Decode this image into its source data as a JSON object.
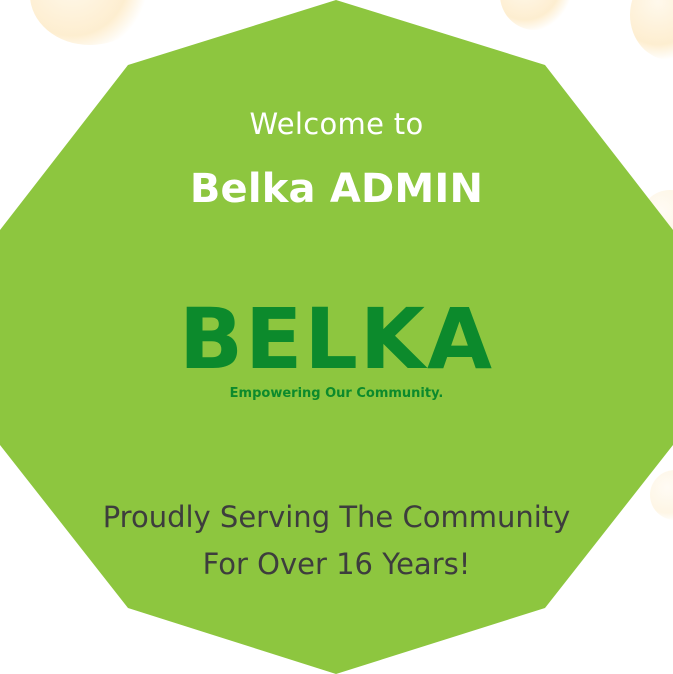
{
  "welcome_text": "Welcome to",
  "title": "Belka ADMIN",
  "logo": {
    "text": "BELKA",
    "tagline": "Empowering Our Community."
  },
  "message": {
    "line1": "Proudly Serving The Community",
    "line2": "For Over 16 Years!"
  },
  "colors": {
    "panel": "#8dc63f",
    "logo": "#0c8a2c",
    "message": "#3d3d3d",
    "heading": "#ffffff"
  }
}
